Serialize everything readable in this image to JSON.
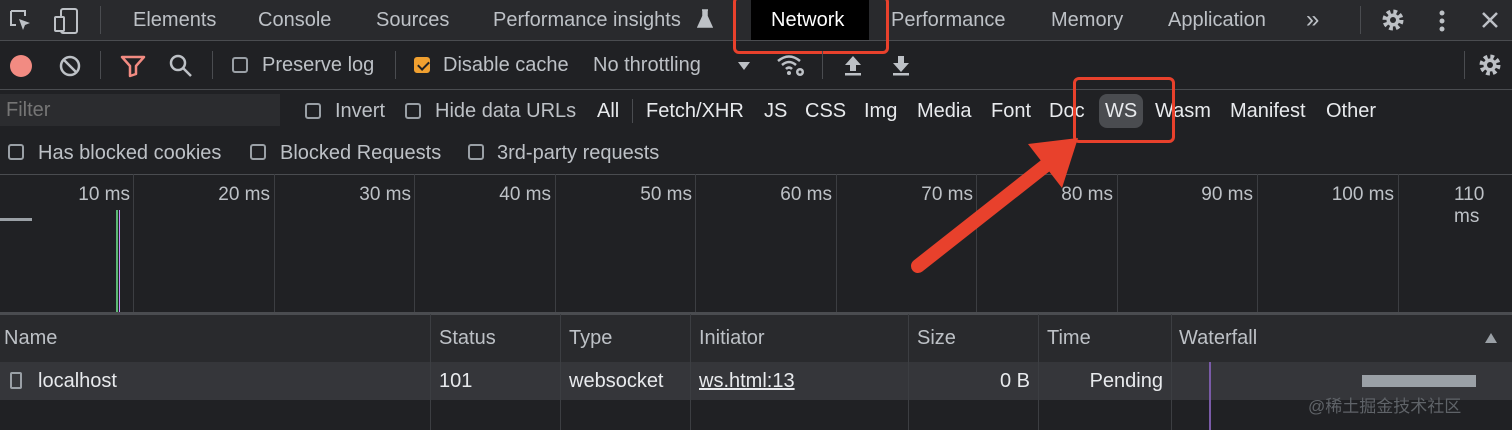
{
  "tabs": [
    "Elements",
    "Console",
    "Sources",
    "Performance insights",
    "Network",
    "Performance",
    "Memory",
    "Application"
  ],
  "more_tabs": "»",
  "toolbar": {
    "preserve_log": "Preserve log",
    "disable_cache": "Disable cache",
    "throttling": "No throttling"
  },
  "filter": {
    "placeholder": "Filter",
    "invert": "Invert",
    "hide_data_urls": "Hide data URLs",
    "types": [
      "All",
      "Fetch/XHR",
      "JS",
      "CSS",
      "Img",
      "Media",
      "Font",
      "Doc",
      "WS",
      "Wasm",
      "Manifest",
      "Other"
    ],
    "selected": "WS"
  },
  "options": {
    "has_blocked_cookies": "Has blocked cookies",
    "blocked_requests": "Blocked Requests",
    "third_party": "3rd-party requests"
  },
  "timeline": {
    "ticks": [
      "10 ms",
      "20 ms",
      "30 ms",
      "40 ms",
      "50 ms",
      "60 ms",
      "70 ms",
      "80 ms",
      "90 ms",
      "100 ms",
      "110 ms"
    ]
  },
  "table": {
    "headers": [
      "Name",
      "Status",
      "Type",
      "Initiator",
      "Size",
      "Time",
      "Waterfall"
    ],
    "rows": [
      {
        "name": "localhost",
        "status": "101",
        "type": "websocket",
        "initiator": "ws.html:13",
        "size": "0 B",
        "time": "Pending"
      }
    ]
  },
  "watermark": "@稀土掘金技术社区",
  "colors": {
    "panel_bg": "#202124",
    "record": "#f28b82",
    "filter_active": "#f28b82",
    "checkbox_checked": "#f0a030",
    "annotation": "#e8412c"
  }
}
